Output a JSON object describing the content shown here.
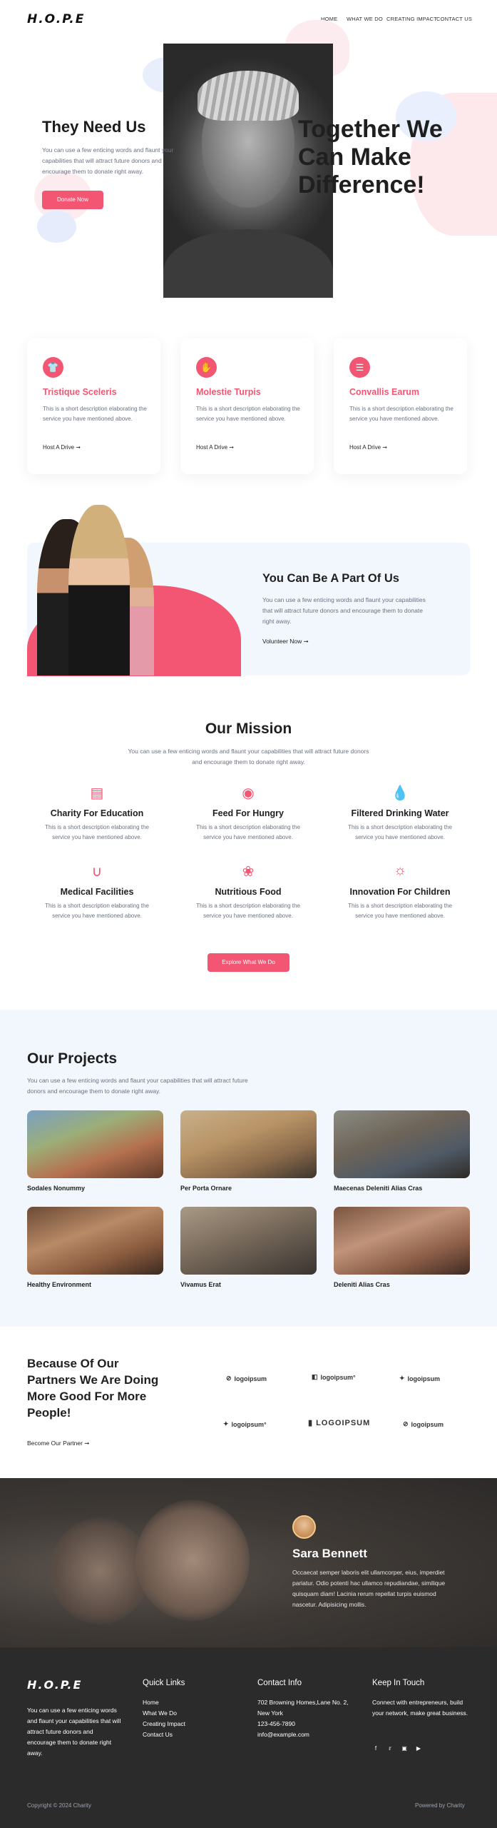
{
  "header": {
    "logo": "H.O.P.E",
    "nav": [
      "HOME",
      "WHAT WE DO",
      "CREATING IMPACT",
      "CONTACT US"
    ]
  },
  "hero": {
    "left_title": "They Need Us",
    "left_text": "You can use a few enticing words and flaunt your capabilities that will attract future donors and encourage them to donate right away.",
    "donate_label": "Donate Now",
    "right_title": "Together We Can Make Difference!"
  },
  "cards": [
    {
      "icon": "shirt-icon",
      "title": "Tristique Sceleris",
      "text": "This is a short description elaborating the service you have mentioned above.",
      "link": "Host A Drive ➞"
    },
    {
      "icon": "hand-icon",
      "title": "Molestie Turpis",
      "text": "This is a short description elaborating the service you have mentioned above.",
      "link": "Host A Drive ➞"
    },
    {
      "icon": "list-icon",
      "title": "Convallis Earum",
      "text": "This is a short description elaborating the service you have mentioned above.",
      "link": "Host A Drive ➞"
    }
  ],
  "part": {
    "title": "You Can Be A Part Of Us",
    "text": "You can use a few enticing words and flaunt your capabilities that will attract future donors and encourage them to donate right away.",
    "link": "Volunteer Now ➞"
  },
  "mission": {
    "title": "Our Mission",
    "text": "You can use a few enticing words and flaunt your capabilities that will attract future donors and encourage them to donate right away.",
    "items": [
      {
        "icon": "book-icon",
        "title": "Charity For Education",
        "text": "This is a short description elaborating the service you have mentioned above."
      },
      {
        "icon": "food-bowl-icon",
        "title": "Feed For Hungry",
        "text": "This is a short description elaborating the service you have mentioned above."
      },
      {
        "icon": "water-drop-icon",
        "title": "Filtered Drinking Water",
        "text": "This is a short description elaborating the service you have mentioned above."
      },
      {
        "icon": "stethoscope-icon",
        "title": "Medical Facilities",
        "text": "This is a short description elaborating the service you have mentioned above."
      },
      {
        "icon": "broccoli-icon",
        "title": "Nutritious Food",
        "text": "This is a short description elaborating the service you have mentioned above."
      },
      {
        "icon": "lightbulb-icon",
        "title": "Innovation For Children",
        "text": "This is a short description elaborating the service you have mentioned above."
      }
    ],
    "button": "Explore What We Do"
  },
  "projects": {
    "title": "Our Projects",
    "text": "You can use a few enticing words and flaunt your capabilities that will attract future donors and encourage them to donate right away.",
    "items": [
      "Sodales Nonummy",
      "Per Porta Ornare",
      "Maecenas Deleniti Alias Cras",
      "Healthy Environment",
      "Vivamus Erat",
      "Deleniti Alias Cras"
    ]
  },
  "partners": {
    "title": "Because Of Our Partners We Are Doing More Good For More People!",
    "link": "Become Our Partner ➞",
    "logos": [
      "logoipsum",
      "logoipsum°",
      "logoipsum",
      "logoipsum°",
      "LOGOIPSUM",
      "logoipsum"
    ]
  },
  "testimonial": {
    "name": "Sara Bennett",
    "text": "Occaecat semper laboris elit ullamcorper, eius, imperdiet pariatur. Odio potenti hac ullamco repudiandae, similique quisquam diam! Lacinia rerum repellat turpis euismod nascetur. Adipisicing mollis."
  },
  "footer": {
    "logo": "H.O.P.E",
    "about": "You can use a few enticing words and flaunt your capabilities that will attract future donors and encourage them to donate right away.",
    "quick_title": "Quick Links",
    "quick_links": [
      "Home",
      "What We Do",
      "Creating Impact",
      "Contact Us"
    ],
    "contact_title": "Contact Info",
    "address": "702 Browning Homes,Lane No. 2, New York",
    "phone": "123-456-7890",
    "email": "info@example.com",
    "touch_title": "Keep In Touch",
    "touch_text": "Connect with entrepreneurs, build your network, make great business.",
    "copyright": "Copyright © 2024 Charity",
    "powered": "Powered by Charity"
  },
  "colors": {
    "accent": "#f25672",
    "light_bg": "#f2f7fd",
    "dark_bg": "#2b2b2b"
  }
}
